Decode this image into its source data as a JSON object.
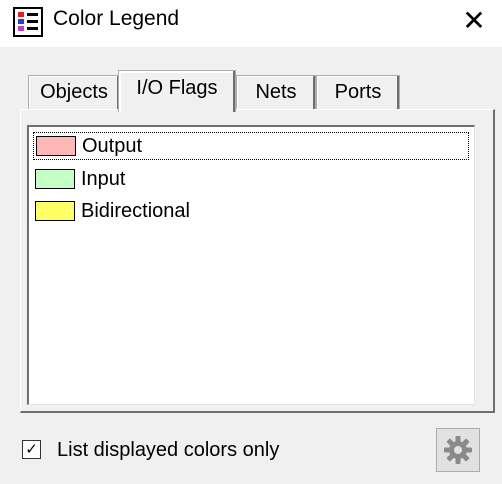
{
  "window": {
    "title": "Color Legend",
    "app_icon": "color-legend-app-icon",
    "close_icon": "close-icon",
    "close_glyph": "✕"
  },
  "tabs": [
    {
      "label": "Objects",
      "active": false
    },
    {
      "label": "I/O Flags",
      "active": true
    },
    {
      "label": "Nets",
      "active": false
    },
    {
      "label": "Ports",
      "active": false
    }
  ],
  "legend": {
    "items": [
      {
        "label": "Output",
        "color": "#ffb6b6",
        "selected": true
      },
      {
        "label": "Input",
        "color": "#c6ffc6",
        "selected": false
      },
      {
        "label": "Bidirectional",
        "color": "#ffff66",
        "selected": false
      }
    ]
  },
  "footer": {
    "checkbox_label": "List displayed colors only",
    "checkbox_checked": true,
    "check_glyph": "✓",
    "settings_icon": "gear-icon"
  }
}
